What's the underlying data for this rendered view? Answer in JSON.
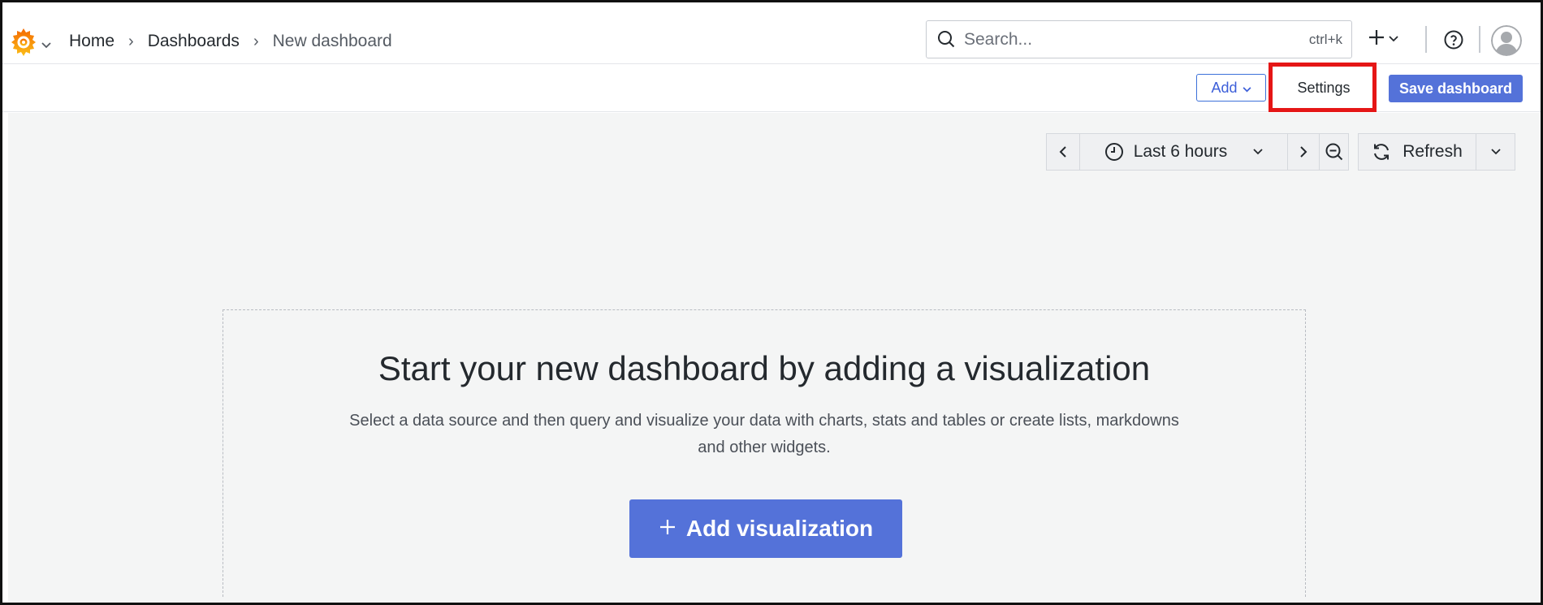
{
  "nav": {
    "breadcrumbs": [
      "Home",
      "Dashboards",
      "New dashboard"
    ],
    "separator": "›"
  },
  "search": {
    "placeholder": "Search...",
    "shortcut": "ctrl+k"
  },
  "toolbar": {
    "add_label": "Add",
    "settings_label": "Settings",
    "save_label": "Save dashboard"
  },
  "timepicker": {
    "range_label": "Last 6 hours",
    "refresh_label": "Refresh"
  },
  "empty_state": {
    "title": "Start your new dashboard by adding a visualization",
    "description": "Select a data source and then query and visualize your data with charts, stats and tables or create lists, markdowns and other widgets.",
    "button_label": "Add visualization"
  },
  "colors": {
    "primary": "#5472d9",
    "highlight": "#e51616",
    "canvas_bg": "#f4f5f5",
    "logo_orange": "#f46800",
    "logo_yellow": "#fbbf18"
  },
  "icons": [
    "grafana-logo-icon",
    "chevron-down-icon",
    "search-icon",
    "plus-icon",
    "help-icon",
    "avatar-icon",
    "chevron-left-icon",
    "clock-icon",
    "chevron-right-icon",
    "zoom-out-icon",
    "refresh-icon"
  ]
}
